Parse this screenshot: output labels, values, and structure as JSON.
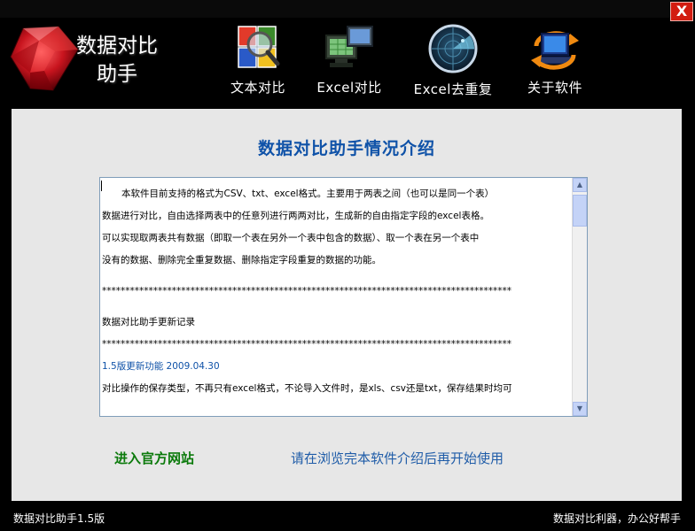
{
  "window": {
    "close_label": "X"
  },
  "logo": {
    "line1": "数据对比",
    "line2": "助手"
  },
  "nav": {
    "items": [
      {
        "label": "文本对比",
        "icon": "text-compare-icon"
      },
      {
        "label": "Excel对比",
        "icon": "excel-compare-icon"
      },
      {
        "label": "Excel去重复",
        "icon": "excel-dedupe-icon"
      },
      {
        "label": "关于软件",
        "icon": "about-icon"
      }
    ]
  },
  "main": {
    "heading": "数据对比助手情况介绍",
    "content": {
      "intro_lines": [
        "本软件目前支持的格式为CSV、txt、excel格式。主要用于两表之间（也可以是同一个表）",
        "数据进行对比，自由选择两表中的任意列进行两两对比，生成新的自由指定字段的excel表格。",
        "可以实现取两表共有数据（即取一个表在另外一个表中包含的数据）、取一个表在另一个表中",
        "没有的数据、删除完全重复数据、删除指定字段重复的数据的功能。"
      ],
      "separator": "****************************************************************************************",
      "log_title": "数据对比助手更新记录",
      "version_line": "1.5版更新功能  2009.04.30",
      "version_detail": "对比操作的保存类型，不再只有excel格式，不论导入文件时，是xls、csv还是txt，保存结果时均可"
    },
    "official_site_link": "进入官方网站",
    "browse_hint": "请在浏览完本软件介绍后再开始使用"
  },
  "status": {
    "left": "数据对比助手1.5版",
    "right": "数据对比利器，办公好帮手"
  },
  "colors": {
    "heading": "#0f52a8",
    "site_link": "#0b7a0b",
    "hint_link": "#1f5ca8",
    "background": "#000000",
    "panel": "#e7e7e7"
  }
}
